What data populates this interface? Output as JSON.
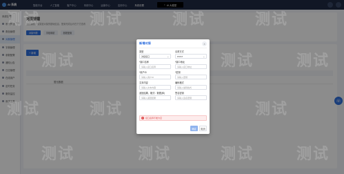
{
  "app": {
    "logo_text": "AI 系统"
  },
  "topnav": [
    "智能平台",
    "人工智能",
    "客户中心",
    "系统中心",
    "运营中心",
    "应用中心",
    "系统设置"
  ],
  "search": {
    "label": "AI 大模型",
    "icon": "search-icon"
  },
  "sidebar": {
    "title": "系统管理",
    "items": [
      "系统管理",
      "角色管理",
      "对象管理",
      "字典管理",
      "参数配置",
      "通知公告",
      "日志管理",
      "在线用户",
      "定时任务",
      "服务监控",
      "系统工具"
    ]
  },
  "page": {
    "title": "对接管理",
    "subtitle": "此处编辑对接渠道对接的基础信息，配置完成后可在下方查看",
    "tabs": [
      "对接列表",
      "字段映射",
      "参数配置"
    ],
    "add_label": "+ 新增",
    "row_text": "暂无数据"
  },
  "modal": {
    "title": "新增对接",
    "close": "×",
    "fields": [
      {
        "label": "类型",
        "required": false,
        "value": "对接接口",
        "placeholder": ""
      },
      {
        "label": "请求方式",
        "required": false,
        "value": "POST",
        "placeholder": ""
      },
      {
        "label": "*接口名称",
        "required": true,
        "value": "",
        "placeholder": "请输入接口名称"
      },
      {
        "label": "*接口地址",
        "required": true,
        "value": "",
        "placeholder": "请输入接口地址"
      },
      {
        "label": "*用户ID",
        "required": true,
        "value": "",
        "placeholder": "请输入用户ID"
      },
      {
        "label": "*密钥",
        "required": true,
        "value": "",
        "placeholder": "请输入密钥"
      },
      {
        "label": "文本内容",
        "required": false,
        "value": "",
        "placeholder": "请输入文本内容"
      },
      {
        "label": "编码格式",
        "required": false,
        "value": "",
        "placeholder": "请输入编码格式"
      },
      {
        "label": "返回结果，格式：数据(体)",
        "required": false,
        "value": "",
        "placeholder": "请输入返回结果"
      },
      {
        "label": "签名密钥",
        "required": false,
        "value": "",
        "placeholder": "请输入签名密钥"
      }
    ],
    "error": "接口名称不能为空",
    "ok_label": "确定",
    "cancel_label": "取消"
  },
  "watermark": "测试",
  "colors": {
    "accent": "#2f6fde",
    "error": "#e04848",
    "topbar": "#1f2a44"
  }
}
